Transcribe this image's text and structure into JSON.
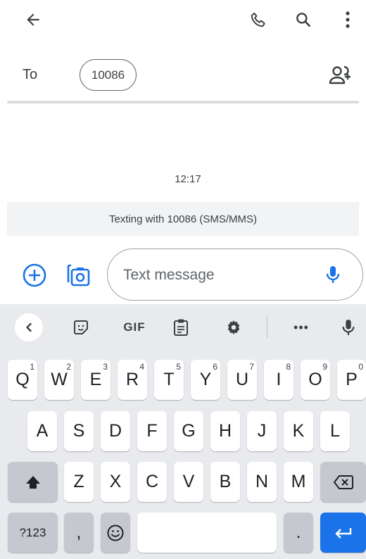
{
  "app_bar": {
    "back_icon": "arrow-left-icon",
    "call_icon": "phone-icon",
    "search_icon": "search-icon",
    "more_icon": "more-vert-icon"
  },
  "recipient": {
    "to_label": "To",
    "chip_label": "10086",
    "add_contact_icon": "add-contact-icon"
  },
  "conversation": {
    "timestamp": "12:17",
    "texting_banner": "Texting with 10086 (SMS/MMS)"
  },
  "compose": {
    "placeholder": "Text message",
    "accent_color": "#1a73e8"
  },
  "keyboard": {
    "toolbar": {
      "gif_label": "GIF",
      "more_label": "•••"
    },
    "row1": [
      {
        "label": "Q",
        "hint": "1"
      },
      {
        "label": "W",
        "hint": "2"
      },
      {
        "label": "E",
        "hint": "3"
      },
      {
        "label": "R",
        "hint": "4"
      },
      {
        "label": "T",
        "hint": "5"
      },
      {
        "label": "Y",
        "hint": "6"
      },
      {
        "label": "U",
        "hint": "7"
      },
      {
        "label": "I",
        "hint": "8"
      },
      {
        "label": "O",
        "hint": "9"
      },
      {
        "label": "P",
        "hint": "0"
      }
    ],
    "row2": [
      "A",
      "S",
      "D",
      "F",
      "G",
      "H",
      "J",
      "K",
      "L"
    ],
    "row3": [
      "Z",
      "X",
      "C",
      "V",
      "B",
      "N",
      "M"
    ],
    "symbols_label": "?123",
    "comma_label": ",",
    "period_label": "."
  }
}
